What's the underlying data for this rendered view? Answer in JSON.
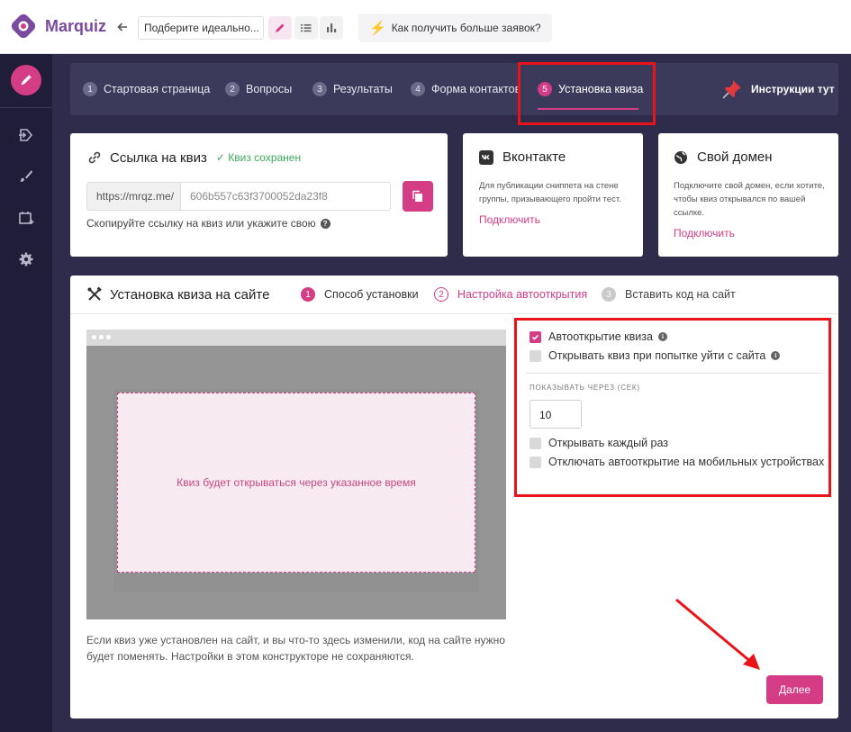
{
  "app": {
    "logo": "Marquiz"
  },
  "topbar": {
    "quiz_name": "Подберите идеально...",
    "tip_label": "Как получить больше заявок?"
  },
  "steps": [
    {
      "num": "1",
      "label": "Стартовая страница"
    },
    {
      "num": "2",
      "label": "Вопросы"
    },
    {
      "num": "3",
      "label": "Результаты"
    },
    {
      "num": "4",
      "label": "Форма контактов"
    },
    {
      "num": "5",
      "label": "Установка квиза",
      "active": true
    }
  ],
  "instructions_label": "Инструкции тут",
  "link_card": {
    "title": "Ссылка на квиз",
    "saved": "✓ Квиз сохранен",
    "prefix": "https://mrqz.me/",
    "value": "606b557c63f3700052da23f8",
    "hint": "Скопируйте ссылку на квиз или укажите свою"
  },
  "vk_card": {
    "title": "Вконтакте",
    "desc": "Для публикации сниппета на стене группы, призывающего пройти тест.",
    "link": "Подключить"
  },
  "domain_card": {
    "title": "Свой домен",
    "desc": "Подключите свой домен, если хотите, чтобы квиз открывался по вашей ссылке.",
    "link": "Подключить"
  },
  "install": {
    "title": "Установка квиза на сайте",
    "sub_steps": [
      {
        "num": "1",
        "label": "Способ установки"
      },
      {
        "num": "2",
        "label": "Настройка автооткрытия"
      },
      {
        "num": "3",
        "label": "Вставить код на сайт"
      }
    ],
    "preview_text": "Квиз будет открываться через указанное время",
    "note": "Если квиз уже установлен на сайт, и вы что-то здесь изменили, код на сайте нужно будет поменять. Настройки в этом конструкторе не сохраняются.",
    "options": {
      "autoopen": "Автооткрытие квиза",
      "exit_intent": "Открывать квиз при попытке уйти с сайта",
      "delay_label": "Показывать через (сек)",
      "delay_value": "10",
      "every_time": "Открывать каждый раз",
      "mobile_off": "Отключать автооткрытие на мобильных устройствах"
    },
    "next_button": "Далее"
  },
  "colors": {
    "accent": "#d43c86",
    "sidebar": "#1f1d38",
    "highlight": "#e8141a"
  }
}
